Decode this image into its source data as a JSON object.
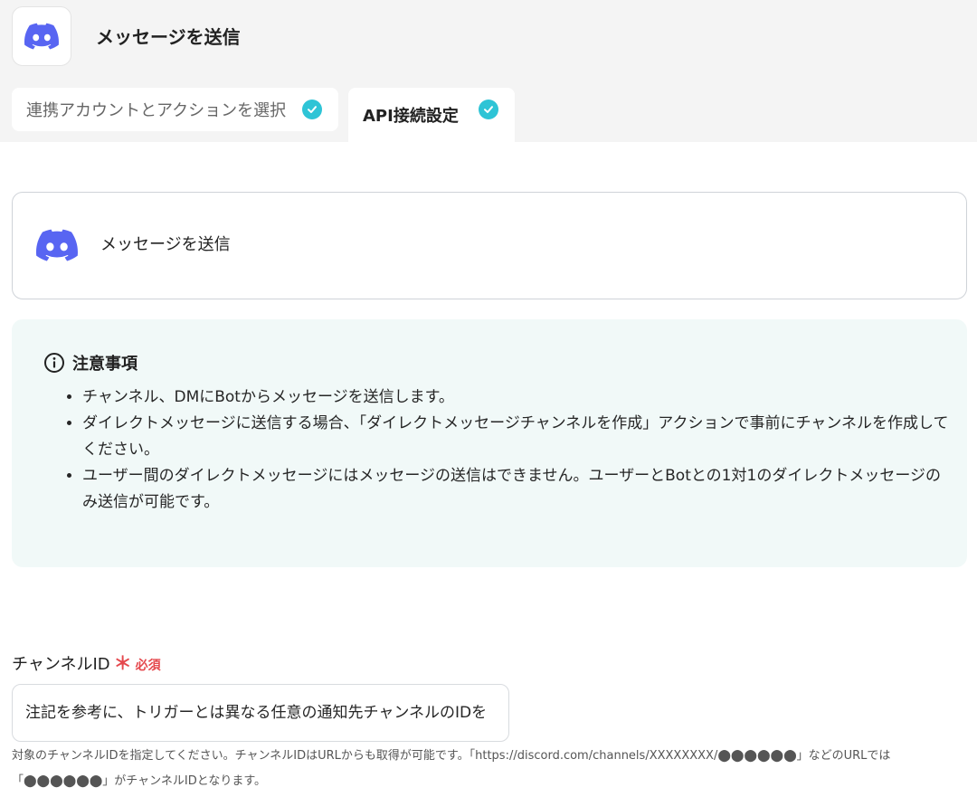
{
  "header": {
    "app_icon": "discord-icon",
    "title": "メッセージを送信"
  },
  "tabs": [
    {
      "label": "連携アカウントとアクションを選択",
      "completed": true
    },
    {
      "label": "API接続設定",
      "completed": true,
      "active": true
    }
  ],
  "action_card": {
    "icon": "discord-icon",
    "label": "メッセージを送信"
  },
  "notice": {
    "title": "注意事項",
    "items": [
      "チャンネル、DMにBotからメッセージを送信します。",
      "ダイレクトメッセージに送信する場合、「ダイレクトメッセージチャンネルを作成」アクションで事前にチャンネルを作成してください。",
      "ユーザー間のダイレクトメッセージにはメッセージの送信はできません。ユーザーとBotとの1対1のダイレクトメッセージのみ送信が可能です。"
    ]
  },
  "field": {
    "label": "チャンネルID",
    "required_mark": "＊",
    "required_text": "必須",
    "placeholder": "注記を参考に、トリガーとは異なる任意の通知先チャンネルのIDを",
    "note": "対象のチャンネルIDを指定してください。チャンネルIDはURLからも取得が可能です。「https://discord.com/channels/XXXXXXXX/⬤⬤⬤⬤⬤⬤」などのURLでは「⬤⬤⬤⬤⬤⬤」がチャンネルIDとなります。"
  },
  "colors": {
    "discord_brand": "#5865F2",
    "check_accent": "#2ec4d6",
    "required": "#e5484d",
    "notice_bg": "#f1f9f8"
  }
}
